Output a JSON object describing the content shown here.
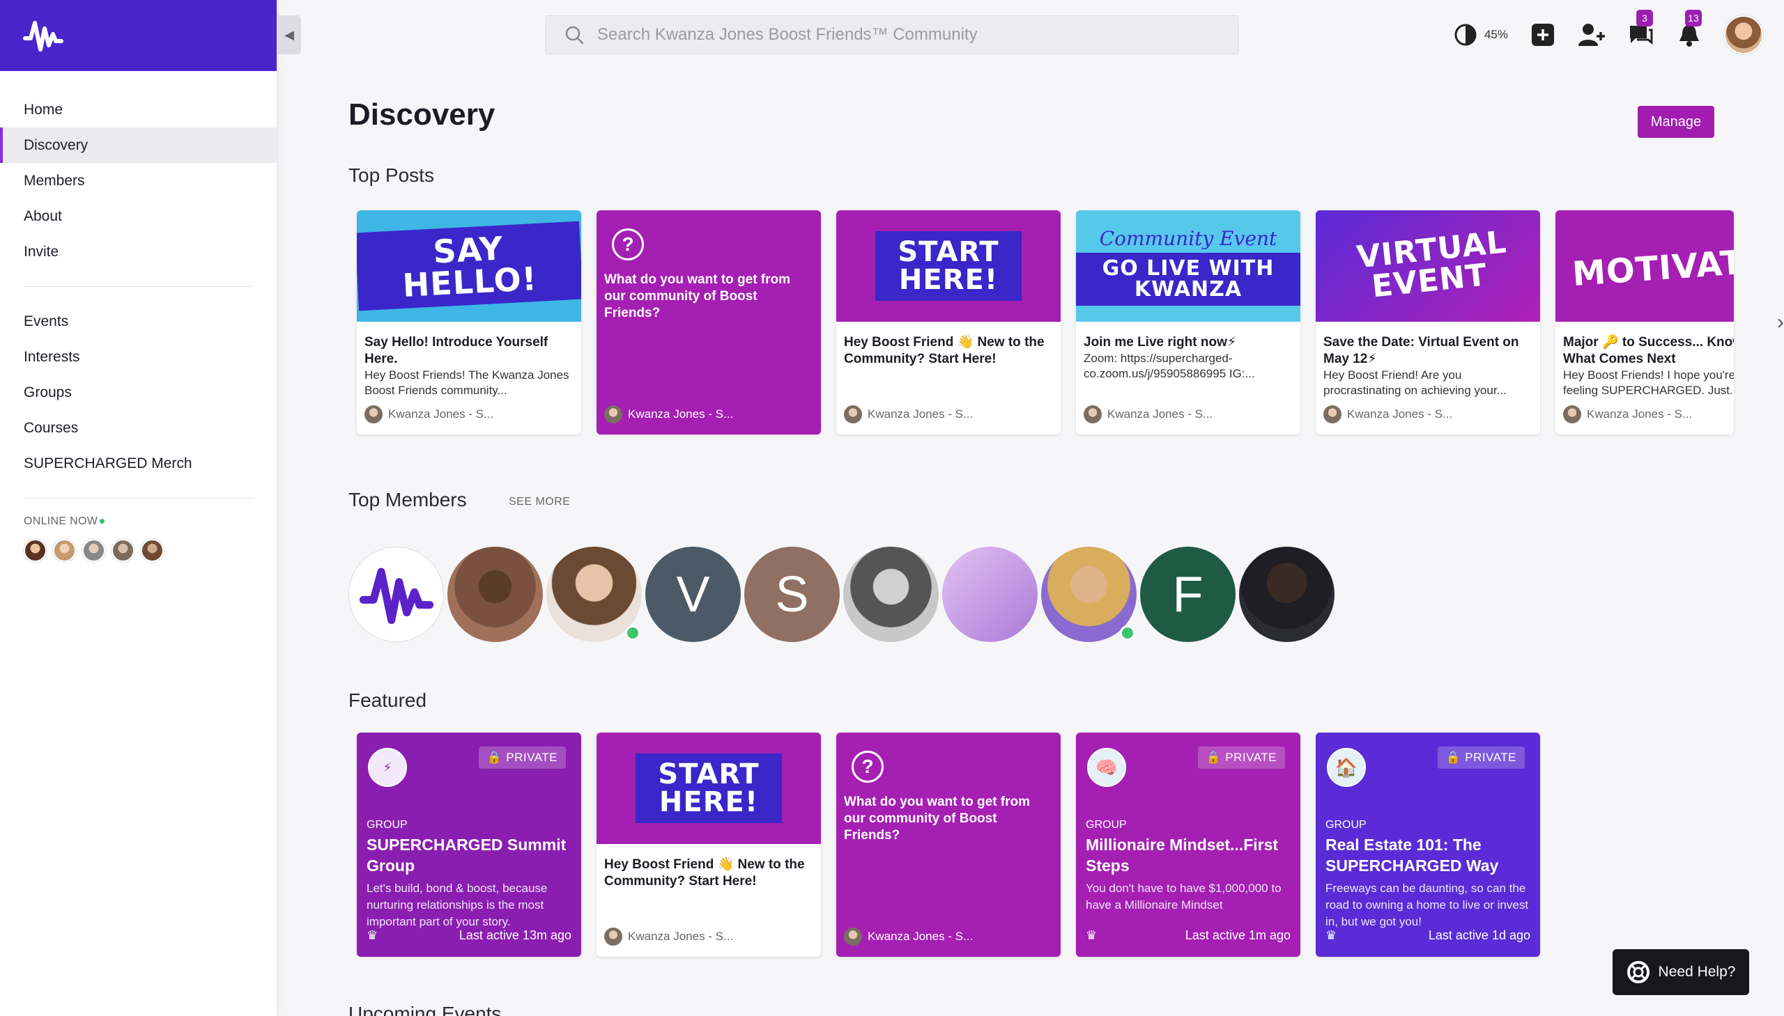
{
  "sidebar": {
    "nav_primary": [
      {
        "label": "Home",
        "active": false
      },
      {
        "label": "Discovery",
        "active": true
      },
      {
        "label": "Members",
        "active": false
      },
      {
        "label": "About",
        "active": false
      },
      {
        "label": "Invite",
        "active": false
      }
    ],
    "nav_secondary": [
      {
        "label": "Events"
      },
      {
        "label": "Interests"
      },
      {
        "label": "Groups"
      },
      {
        "label": "Courses"
      },
      {
        "label": "SUPERCHARGED Merch"
      }
    ],
    "online_label": "ONLINE NOW"
  },
  "topbar": {
    "search_placeholder": "Search Kwanza Jones Boost Friends™ Community",
    "contrast_value": "45%",
    "messages_badge": "3",
    "notifications_badge": "13"
  },
  "main": {
    "title": "Discovery",
    "manage_label": "Manage",
    "top_posts_title": "Top Posts",
    "top_members_title": "Top Members",
    "see_more_label": "SEE MORE",
    "featured_title": "Featured",
    "upcoming_title": "Upcoming Events"
  },
  "top_posts": [
    {
      "banner": "SAY HELLO!",
      "title": "Say Hello! Introduce Yourself Here.",
      "excerpt": "Hey Boost Friends! The Kwanza Jones Boost Friends community...",
      "author": "Kwanza Jones - S..."
    },
    {
      "question": "What do you want to get from our community of Boost Friends?",
      "author": "Kwanza Jones - S..."
    },
    {
      "banner": "START HERE!",
      "title": "Hey Boost Friend 👋 New to the Community? Start Here!",
      "author": "Kwanza Jones - S..."
    },
    {
      "banner_script": "Community Event",
      "banner": "GO LIVE WITH KWANZA",
      "title": "Join me Live right now⚡",
      "excerpt": "Zoom: https://supercharged-co.zoom.us/j/95905886995 IG:...",
      "author": "Kwanza Jones - S..."
    },
    {
      "banner": "VIRTUAL EVENT",
      "title": "Save the Date: Virtual Event on May 12⚡",
      "excerpt": "Hey Boost Friend!  Are you procrastinating on achieving your...",
      "author": "Kwanza Jones - S..."
    },
    {
      "banner": "MOTIVATION",
      "title": "Major 🔑 to Success... Know What Comes Next",
      "excerpt": "Hey Boost Friends! I hope you're feeling SUPERCHARGED. Just...",
      "author": "Kwanza Jones - S..."
    }
  ],
  "top_members": [
    {
      "initial": "",
      "color": "#ffffff",
      "online": false
    },
    {
      "initial": "",
      "color": "#8d6e63",
      "online": false
    },
    {
      "initial": "",
      "color": "#d9b59a",
      "online": true
    },
    {
      "initial": "V",
      "color": "#4b5a66",
      "online": false
    },
    {
      "initial": "S",
      "color": "#8f7062",
      "online": false
    },
    {
      "initial": "",
      "color": "#a9a9a9",
      "online": false
    },
    {
      "initial": "",
      "color": "#c9a7e6",
      "online": false
    },
    {
      "initial": "",
      "color": "#d8b57a",
      "online": true
    },
    {
      "initial": "F",
      "color": "#1f5a45",
      "online": false
    },
    {
      "initial": "",
      "color": "#3b2a24",
      "online": false
    }
  ],
  "featured": [
    {
      "private_label": "PRIVATE",
      "kind": "GROUP",
      "title": "SUPERCHARGED Summit Group",
      "description": "Let's build, bond & boost, because nurturing relationships is the most important part of your story.",
      "last_active": "Last active 13m ago"
    },
    {
      "banner": "START HERE!",
      "title": "Hey Boost Friend 👋 New to the Community? Start Here!",
      "author": "Kwanza Jones - S..."
    },
    {
      "question": "What do you want to get from our community of Boost Friends?",
      "author": "Kwanza Jones - S..."
    },
    {
      "private_label": "PRIVATE",
      "kind": "GROUP",
      "title": "Millionaire Mindset...First Steps",
      "description": "You don't have to have $1,000,000 to have a Millionaire Mindset",
      "last_active": "Last active 1m ago"
    },
    {
      "private_label": "PRIVATE",
      "kind": "GROUP",
      "title": "Real Estate 101: The SUPERCHARGED Way",
      "description": "Freeways can be daunting, so can the road to owning a home to live or invest in, but we got you!",
      "last_active": "Last active 1d ago"
    }
  ],
  "help": {
    "label": "Need Help?"
  },
  "colors": {
    "brand": "#4a25cc",
    "accent": "#a21cb0",
    "group_blue": "#5a2bd6"
  }
}
